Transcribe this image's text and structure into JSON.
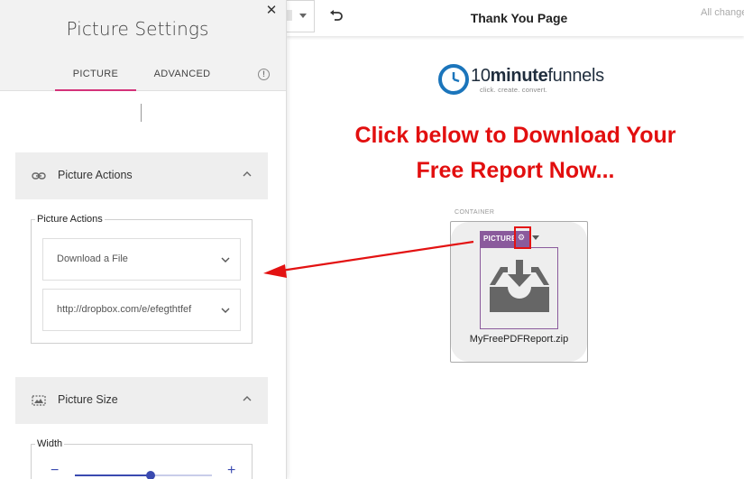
{
  "panel": {
    "title": "Picture Settings",
    "tabs": [
      {
        "label": "PICTURE",
        "active": true
      },
      {
        "label": "ADVANCED",
        "active": false
      }
    ],
    "sections": {
      "actions": {
        "title": "Picture Actions",
        "icon": "link-icon",
        "group_legend": "Picture Actions",
        "action_select": "Download a File",
        "url_select": "http://dropbox.com/e/efegthtfef"
      },
      "size": {
        "title": "Picture Size",
        "icon": "image-size-icon",
        "width_legend": "Width",
        "width_level": 0.55
      }
    }
  },
  "topbar": {
    "page_title": "Thank You Page",
    "save_status": "All changes saved"
  },
  "canvas": {
    "logo": {
      "number": "10",
      "minute": "minute",
      "funnels": "funnels",
      "tagline": "click. create. convert."
    },
    "headline_line1": "Click below to Download Your",
    "headline_line2": "Free Report Now...",
    "container_label": "CONTAINER",
    "picture_tag": "PICTURE",
    "file_caption": "MyFreePDFReport.zip"
  },
  "colors": {
    "headline_red": "#e20f0f",
    "tab_underline": "#d4337a",
    "picture_tag_purple": "#8a5a9c",
    "slider_blue": "#3a4ab0",
    "logo_blue": "#1b75bb"
  }
}
